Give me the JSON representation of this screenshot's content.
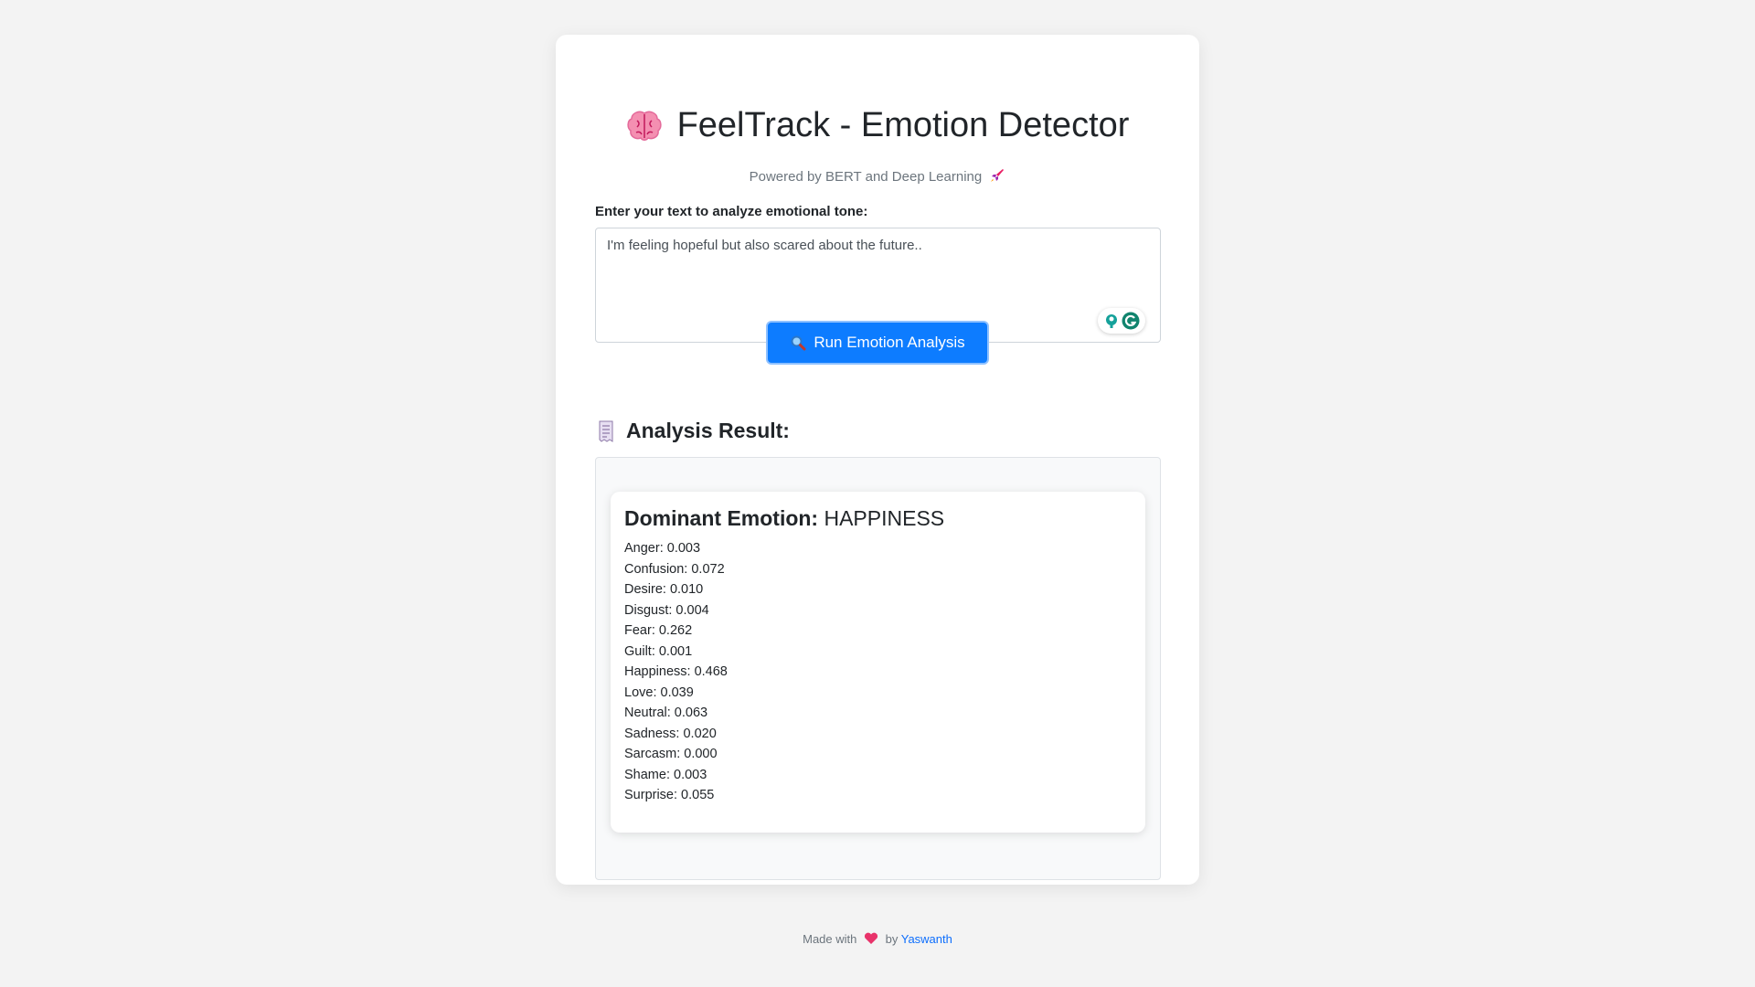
{
  "app": {
    "title": "FeelTrack - Emotion Detector",
    "subtitle": "Powered by BERT and Deep Learning"
  },
  "form": {
    "label": "Enter your text to analyze emotional tone:",
    "text_value": "I'm feeling hopeful but also scared about the future..",
    "button_label": "Run Emotion Analysis"
  },
  "result": {
    "heading": "Analysis Result:",
    "dominant_label": "Dominant Emotion:",
    "dominant_value": "HAPPINESS",
    "emotions": [
      "Anger: 0.003",
      "Confusion: 0.072",
      "Desire: 0.010",
      "Disgust: 0.004",
      "Fear: 0.262",
      "Guilt: 0.001",
      "Happiness: 0.468",
      "Love: 0.039",
      "Neutral: 0.063",
      "Sadness: 0.020",
      "Sarcasm: 0.000",
      "Shame: 0.003",
      "Surprise: 0.055"
    ]
  },
  "footer": {
    "made_with": "Made with",
    "by": "by",
    "author": "Yaswanth"
  },
  "colors": {
    "accent": "#0d7cff",
    "background": "#f3f3f3",
    "heart": "#e8336a"
  },
  "icons": {
    "title": "brain-icon",
    "subtitle": "rocket-icon",
    "button": "magnifier-icon",
    "result": "receipt-icon",
    "footer": "heart-icon"
  }
}
